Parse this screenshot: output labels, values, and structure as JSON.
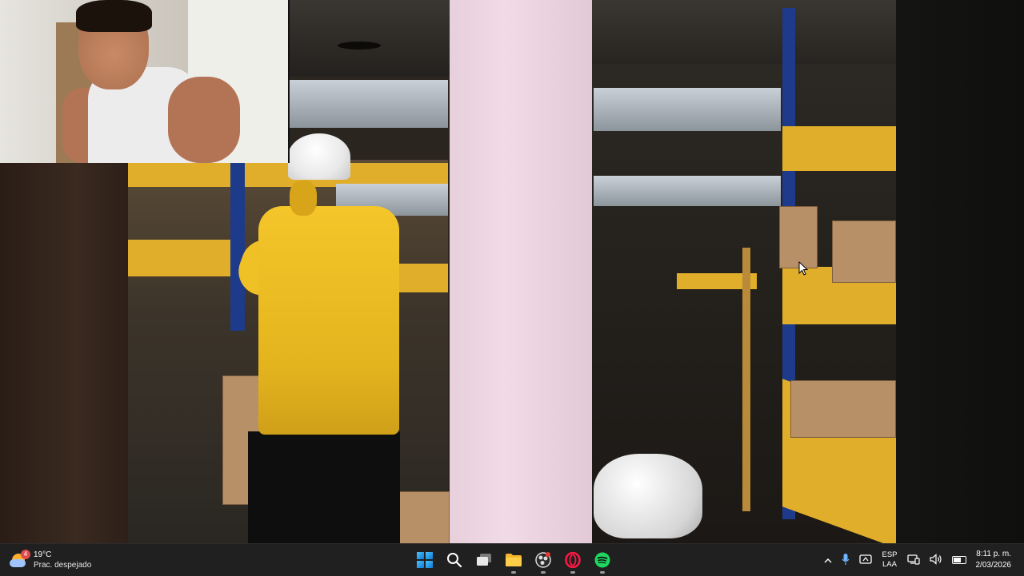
{
  "taskbar": {
    "weather": {
      "temperature": "19°C",
      "condition": "Prac. despejado",
      "badge_count": "4",
      "icon": "weather-sun-cloud-icon"
    },
    "pinned_apps": [
      {
        "name": "start",
        "icon": "windows-logo-icon"
      },
      {
        "name": "search",
        "icon": "search-icon"
      },
      {
        "name": "task-view",
        "icon": "task-view-icon"
      },
      {
        "name": "file-explorer",
        "icon": "folder-icon"
      },
      {
        "name": "obs",
        "icon": "obs-studio-icon"
      },
      {
        "name": "opera-gx",
        "icon": "opera-gx-icon"
      },
      {
        "name": "spotify",
        "icon": "spotify-icon"
      }
    ],
    "tray": {
      "language_line1": "ESP",
      "language_line2": "LAA",
      "time": "8:11 p. m.",
      "date": "2/03/2026"
    }
  },
  "colors": {
    "taskbar_bg": "#202020",
    "accent": "#4cc2ff",
    "helmet": "#ffffff",
    "shirt": "#f4c62a"
  }
}
